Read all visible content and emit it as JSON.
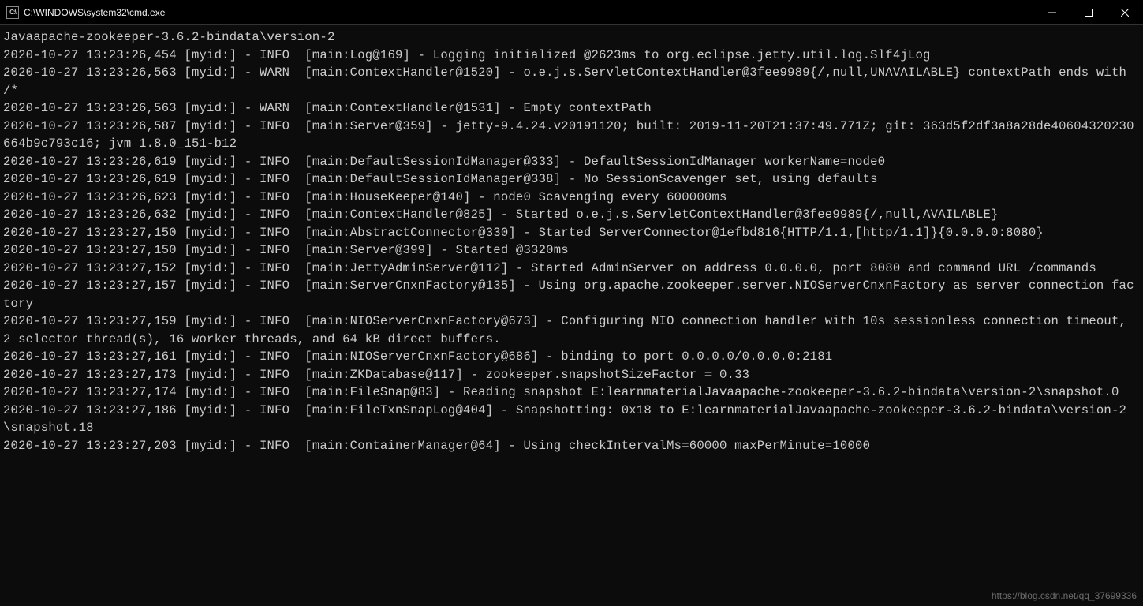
{
  "titlebar": {
    "icon_label": "C:\\",
    "title": "C:\\WINDOWS\\system32\\cmd.exe"
  },
  "console": {
    "lines": [
      "Javaapache-zookeeper-3.6.2-bindata\\version-2",
      "2020-10-27 13:23:26,454 [myid:] - INFO  [main:Log@169] - Logging initialized @2623ms to org.eclipse.jetty.util.log.Slf4jLog",
      "2020-10-27 13:23:26,563 [myid:] - WARN  [main:ContextHandler@1520] - o.e.j.s.ServletContextHandler@3fee9989{/,null,UNAVAILABLE} contextPath ends with /*",
      "2020-10-27 13:23:26,563 [myid:] - WARN  [main:ContextHandler@1531] - Empty contextPath",
      "2020-10-27 13:23:26,587 [myid:] - INFO  [main:Server@359] - jetty-9.4.24.v20191120; built: 2019-11-20T21:37:49.771Z; git: 363d5f2df3a8a28de40604320230664b9c793c16; jvm 1.8.0_151-b12",
      "2020-10-27 13:23:26,619 [myid:] - INFO  [main:DefaultSessionIdManager@333] - DefaultSessionIdManager workerName=node0",
      "2020-10-27 13:23:26,619 [myid:] - INFO  [main:DefaultSessionIdManager@338] - No SessionScavenger set, using defaults",
      "2020-10-27 13:23:26,623 [myid:] - INFO  [main:HouseKeeper@140] - node0 Scavenging every 600000ms",
      "2020-10-27 13:23:26,632 [myid:] - INFO  [main:ContextHandler@825] - Started o.e.j.s.ServletContextHandler@3fee9989{/,null,AVAILABLE}",
      "2020-10-27 13:23:27,150 [myid:] - INFO  [main:AbstractConnector@330] - Started ServerConnector@1efbd816{HTTP/1.1,[http/1.1]}{0.0.0.0:8080}",
      "2020-10-27 13:23:27,150 [myid:] - INFO  [main:Server@399] - Started @3320ms",
      "2020-10-27 13:23:27,152 [myid:] - INFO  [main:JettyAdminServer@112] - Started AdminServer on address 0.0.0.0, port 8080 and command URL /commands",
      "2020-10-27 13:23:27,157 [myid:] - INFO  [main:ServerCnxnFactory@135] - Using org.apache.zookeeper.server.NIOServerCnxnFactory as server connection factory",
      "2020-10-27 13:23:27,159 [myid:] - INFO  [main:NIOServerCnxnFactory@673] - Configuring NIO connection handler with 10s sessionless connection timeout, 2 selector thread(s), 16 worker threads, and 64 kB direct buffers.",
      "2020-10-27 13:23:27,161 [myid:] - INFO  [main:NIOServerCnxnFactory@686] - binding to port 0.0.0.0/0.0.0.0:2181",
      "2020-10-27 13:23:27,173 [myid:] - INFO  [main:ZKDatabase@117] - zookeeper.snapshotSizeFactor = 0.33",
      "2020-10-27 13:23:27,174 [myid:] - INFO  [main:FileSnap@83] - Reading snapshot E:learnmaterialJavaapache-zookeeper-3.6.2-bindata\\version-2\\snapshot.0",
      "2020-10-27 13:23:27,186 [myid:] - INFO  [main:FileTxnSnapLog@404] - Snapshotting: 0x18 to E:learnmaterialJavaapache-zookeeper-3.6.2-bindata\\version-2\\snapshot.18",
      "2020-10-27 13:23:27,203 [myid:] - INFO  [main:ContainerManager@64] - Using checkIntervalMs=60000 maxPerMinute=10000"
    ]
  },
  "watermark": "https://blog.csdn.net/qq_37699336"
}
